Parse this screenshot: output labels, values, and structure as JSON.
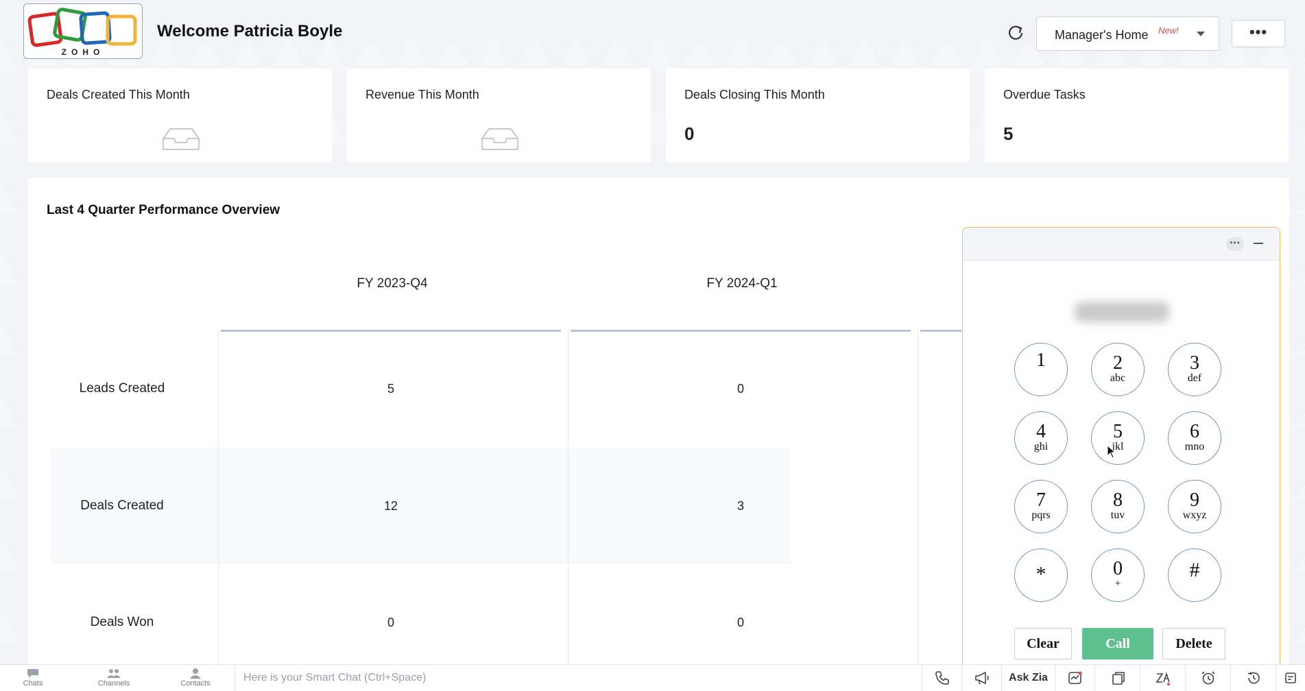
{
  "header": {
    "logo_text": "ZOHO",
    "welcome": "Welcome Patricia Boyle",
    "home_select": "Manager's Home",
    "home_badge": "New!",
    "more_label": "•••"
  },
  "kpis": [
    {
      "title": "Deals Created This Month",
      "value": null
    },
    {
      "title": "Revenue This Month",
      "value": null
    },
    {
      "title": "Deals Closing This Month",
      "value": "0"
    },
    {
      "title": "Overdue Tasks",
      "value": "5"
    }
  ],
  "performance": {
    "title": "Last 4 Quarter Performance Overview",
    "columns": [
      "FY 2023-Q4",
      "FY 2024-Q1"
    ],
    "rows": [
      {
        "label": "Leads Created",
        "values": [
          "5",
          "0"
        ]
      },
      {
        "label": "Deals Created",
        "values": [
          "12",
          "3"
        ]
      },
      {
        "label": "Deals Won",
        "values": [
          "0",
          "0"
        ]
      }
    ]
  },
  "dialer": {
    "more_label": "•••",
    "keys": [
      {
        "digit": "1",
        "letters": ""
      },
      {
        "digit": "2",
        "letters": "abc"
      },
      {
        "digit": "3",
        "letters": "def"
      },
      {
        "digit": "4",
        "letters": "ghi"
      },
      {
        "digit": "5",
        "letters": "jkl"
      },
      {
        "digit": "6",
        "letters": "mno"
      },
      {
        "digit": "7",
        "letters": "pqrs"
      },
      {
        "digit": "8",
        "letters": "tuv"
      },
      {
        "digit": "9",
        "letters": "wxyz"
      },
      {
        "digit": "*",
        "letters": ""
      },
      {
        "digit": "0",
        "letters": "+"
      },
      {
        "digit": "#",
        "letters": ""
      }
    ],
    "clear_label": "Clear",
    "call_label": "Call",
    "delete_label": "Delete"
  },
  "bottom_bar": {
    "chats": "Chats",
    "channels": "Channels",
    "contacts": "Contacts",
    "chat_placeholder": "Here is your Smart Chat (Ctrl+Space)",
    "ask_zia": "Ask Zia"
  },
  "colors": {
    "accent_call": "#5ec08f",
    "new_badge": "#e04b4b",
    "dialer_border": "#e8c060"
  }
}
